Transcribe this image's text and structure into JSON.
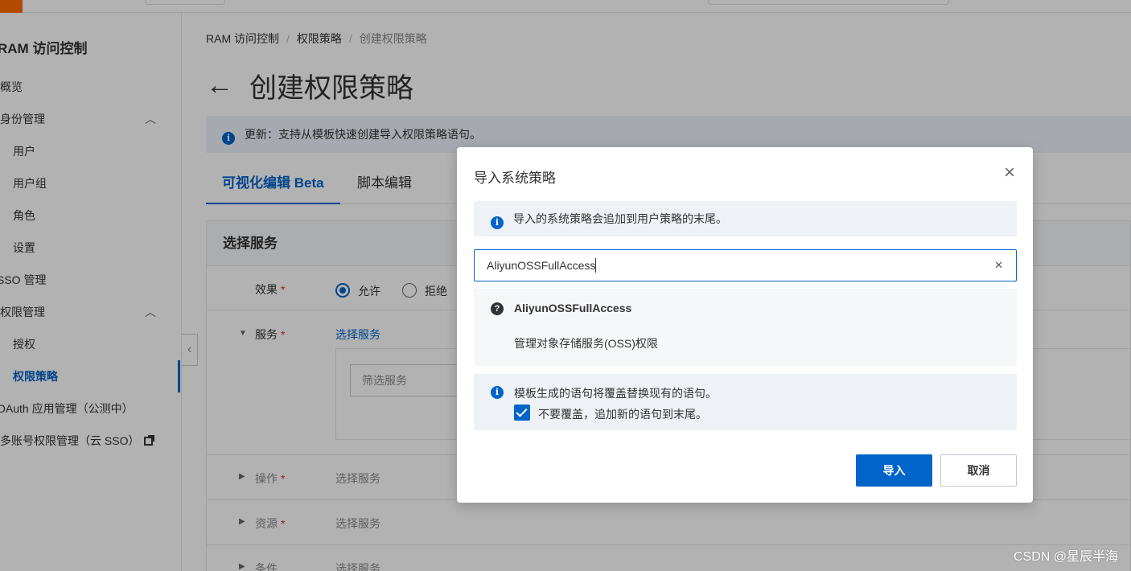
{
  "sidebar": {
    "title": "RAM 访问控制",
    "items": [
      {
        "label": "概览"
      },
      {
        "label": "身份管理"
      },
      {
        "label": "用户"
      },
      {
        "label": "用户组"
      },
      {
        "label": "角色"
      },
      {
        "label": "设置"
      },
      {
        "label": "SSO 管理"
      },
      {
        "label": "权限管理"
      },
      {
        "label": "授权"
      },
      {
        "label": "权限策略"
      },
      {
        "label": "OAuth 应用管理（公测中）"
      },
      {
        "label": "多账号权限管理（云 SSO）"
      }
    ]
  },
  "breadcrumb": {
    "items": [
      "RAM 访问控制",
      "权限策略",
      "创建权限策略"
    ]
  },
  "page": {
    "title": "创建权限策略",
    "back_icon": "←",
    "notice": "更新：支持从模板快速创建导入权限策略语句。"
  },
  "tabs": [
    "可视化编辑 Beta",
    "脚本编辑"
  ],
  "card": {
    "title": "选择服务",
    "effect_label": "效果",
    "allow_label": "允许",
    "deny_label": "拒绝",
    "service_label": "服务",
    "service_link": "选择服务",
    "filter_placeholder": "筛选服务",
    "action_label": "操作",
    "action_value": "选择服务",
    "resource_label": "资源",
    "resource_value": "选择服务",
    "condition_label": "条件",
    "condition_value": "选择服务"
  },
  "dialog": {
    "title": "导入系统策略",
    "info": "导入的系统策略会追加到用户策略的末尾。",
    "search_value": "AliyunOSSFullAccess",
    "result_name": "AliyunOSSFullAccess",
    "result_desc": "管理对象存储服务(OSS)权限",
    "warn_text": "模板生成的语句将覆盖替换现有的语句。",
    "checkbox_label": "不要覆盖，追加新的语句到末尾。",
    "checkbox_checked": true,
    "import_button": "导入",
    "cancel_button": "取消"
  },
  "watermark": "CSDN @星辰半海",
  "colors": {
    "primary": "#0064c8",
    "required": "#d93026",
    "brand": "#ff6a00"
  }
}
